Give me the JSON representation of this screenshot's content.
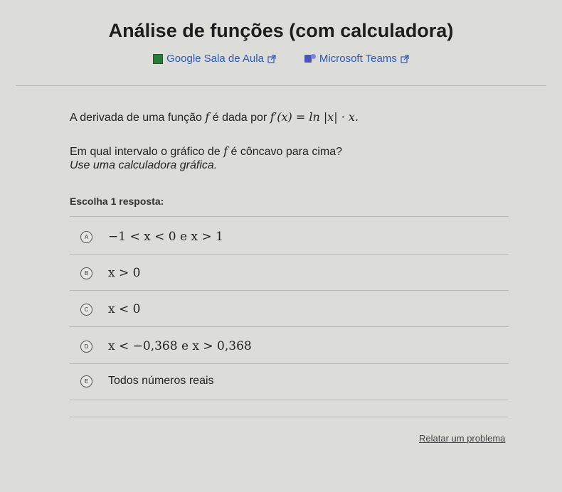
{
  "page": {
    "title": "Análise de funções (com calculadora)"
  },
  "links": [
    {
      "label": "Google Sala de Aula",
      "icon": "google-classroom-icon"
    },
    {
      "label": "Microsoft Teams",
      "icon": "microsoft-teams-icon"
    }
  ],
  "question": {
    "line1_prefix": "A derivada de uma função",
    "line1_fn": "f",
    "line1_mid": "é dada por",
    "line1_formula": "f′(x) = ln |x| · x.",
    "line2_prefix": "Em qual intervalo o gráfico de",
    "line2_fn": "f",
    "line2_suffix": "é côncavo para cima?",
    "hint": "Use uma calculadora gráfica."
  },
  "instruction": "Escolha 1 resposta:",
  "options": [
    {
      "letter": "A",
      "text": "−1 < x < 0 e x > 1"
    },
    {
      "letter": "B",
      "text": "x > 0"
    },
    {
      "letter": "C",
      "text": "x < 0"
    },
    {
      "letter": "D",
      "text": "x < −0,368 e x > 0,368"
    },
    {
      "letter": "E",
      "text": "Todos números reais"
    }
  ],
  "footer": {
    "report": "Relatar um problema"
  },
  "colors": {
    "link": "#2f57b6",
    "background": "#dcdcd8"
  }
}
